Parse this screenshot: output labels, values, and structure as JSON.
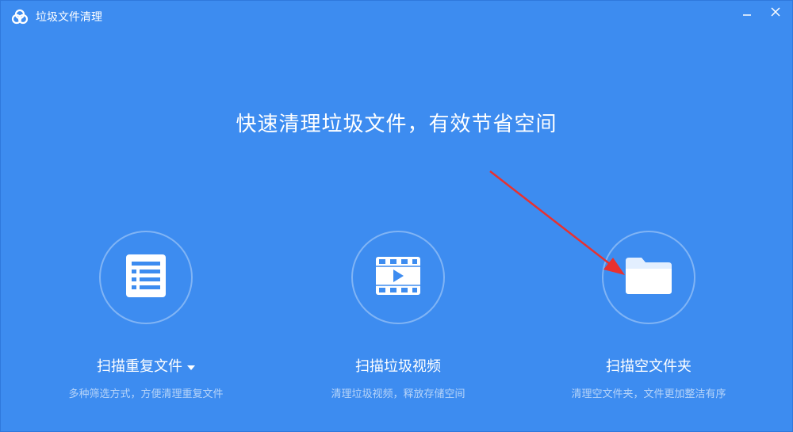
{
  "window": {
    "title": "垃圾文件清理",
    "app_icon": "cloud-icon",
    "minimize_icon": "minimize-icon",
    "close_icon": "close-icon"
  },
  "colors": {
    "background": "#3d8cf0",
    "annotation_arrow": "#e8312f"
  },
  "headline": "快速清理垃圾文件，有效节省空间",
  "features": [
    {
      "icon": "list-document-icon",
      "label": "扫描重复文件",
      "has_dropdown": true,
      "description": "多种筛选方式，方便清理重复文件"
    },
    {
      "icon": "video-film-icon",
      "label": "扫描垃圾视频",
      "has_dropdown": false,
      "description": "清理垃圾视频，释放存储空间"
    },
    {
      "icon": "folder-icon",
      "label": "扫描空文件夹",
      "has_dropdown": false,
      "description": "清理空文件夹，文件更加整洁有序"
    }
  ]
}
